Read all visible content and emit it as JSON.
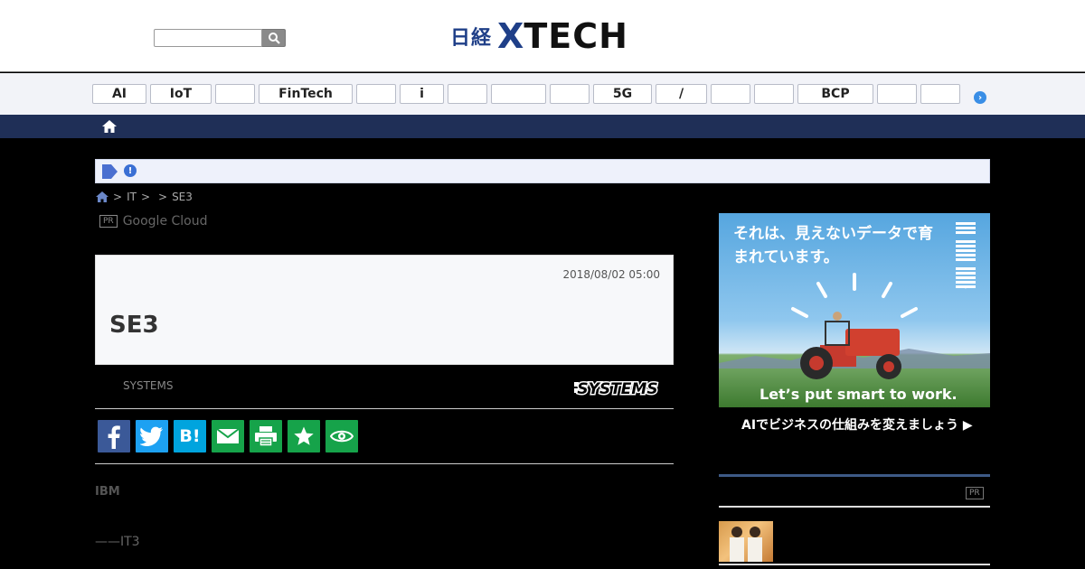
{
  "header": {
    "search": {
      "placeholder": ""
    },
    "logo": {
      "jp": "日経",
      "x": "X",
      "tech": "TECH"
    }
  },
  "categories": [
    "AI",
    "IoT",
    "",
    "FinTech",
    "",
    "i",
    "",
    "",
    "",
    "5G",
    "/",
    "",
    "",
    "BCP",
    "",
    ""
  ],
  "notice": {
    "text": ""
  },
  "breadcrumb": [
    ">",
    "IT",
    ">",
    ">",
    "SE3"
  ],
  "pr_line": {
    "badge": "PR",
    "text": "Google Cloud"
  },
  "article": {
    "date": "2018/08/02 05:00",
    "title": "SE3",
    "source": "SYSTEMS",
    "source_logo": "SYSTEMS",
    "body_heading": "IBM",
    "body_text": "——IT3"
  },
  "share_buttons": [
    {
      "name": "facebook-icon",
      "color": "#3b5998"
    },
    {
      "name": "twitter-icon",
      "color": "#1da1f2"
    },
    {
      "name": "hatena-icon",
      "color": "#00a4de",
      "label": "B!"
    },
    {
      "name": "mail-icon",
      "color": "#16a34a"
    },
    {
      "name": "print-icon",
      "color": "#16a34a"
    },
    {
      "name": "star-icon",
      "color": "#16a34a"
    },
    {
      "name": "watch-icon",
      "color": "#16a34a"
    }
  ],
  "ad": {
    "headline": "それは、見えないデータで育まれています。",
    "brand": "IBM",
    "slogan": "Let’s put smart to work.",
    "cta": "AIでビジネスの仕組みを変えましょう ▶"
  },
  "sidebar": {
    "pr_badge": "PR"
  }
}
